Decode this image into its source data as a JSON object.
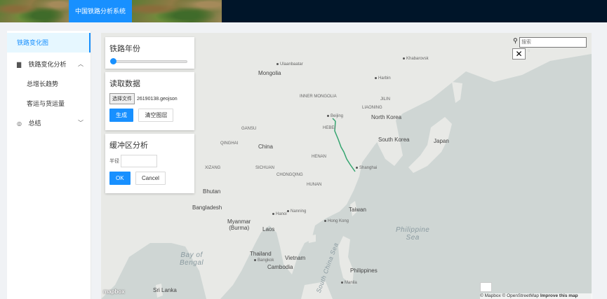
{
  "header": {
    "title": "中国铁路分析系统"
  },
  "sidebar": {
    "items": [
      {
        "label": "铁路变化图",
        "active": true
      },
      {
        "label": "铁路变化分析",
        "icon": "chart-icon",
        "expanded": true
      },
      {
        "label": "总增长趋势"
      },
      {
        "label": "客运与货运量"
      },
      {
        "label": "总结",
        "icon": "summary-icon",
        "expanded": false
      }
    ]
  },
  "panels": {
    "year": {
      "title": "铁路年份",
      "slider_value": 0
    },
    "read": {
      "title": "读取数据",
      "file_button": "选择文件",
      "file_name": "26190138.geojson",
      "generate": "生成",
      "clear": "清空图层"
    },
    "buffer": {
      "title": "缓冲区分析",
      "radius_label": "半径",
      "ok": "OK",
      "cancel": "Cancel"
    }
  },
  "map": {
    "search_placeholder": "搜索",
    "close_glyph": "✕",
    "logo": "mapbox",
    "attribution_a": "© Mapbox © OpenStreetMap",
    "attribution_b": "Improve this map",
    "labels": {
      "mongolia": "Mongolia",
      "china": "China",
      "north_korea": "North Korea",
      "south_korea": "South Korea",
      "japan": "Japan",
      "bangladesh": "Bangladesh",
      "myanmar": "Myanmar\n(Burma)",
      "laos": "Laos",
      "thailand": "Thailand",
      "vietnam": "Vietnam",
      "cambodia": "Cambodia",
      "philippines": "Philippines",
      "taiwan": "Taiwan",
      "bhutan": "Bhutan",
      "sri_lanka": "Sri Lanka",
      "bay_of_bengal": "Bay of\nBengal",
      "philippine_sea": "Philippine\nSea",
      "south_china_sea": "South China Sea",
      "ulaanbaatar": "Ulaanbaatar",
      "beijing": "Beijing",
      "harbin": "Harbin",
      "shanghai": "Shanghai",
      "hong_kong": "Hong Kong",
      "nanning": "Nanning",
      "hanoi": "Hanoi",
      "chongqing": "CHONGQING",
      "hebei": "HEBEI",
      "henan": "HENAN",
      "hunan": "HUNAN",
      "sichuan": "SICHUAN",
      "xizang": "XIZANG",
      "qinghai": "QINGHAI",
      "gansu": "GANSU",
      "inner_mongolia": "INNER MONGOLIA",
      "jilin": "JILIN",
      "liaoning": "LIAONING",
      "manila": "Manila",
      "bangkok": "Bangkok",
      "khabarovsk": "Khabarovsk"
    }
  }
}
